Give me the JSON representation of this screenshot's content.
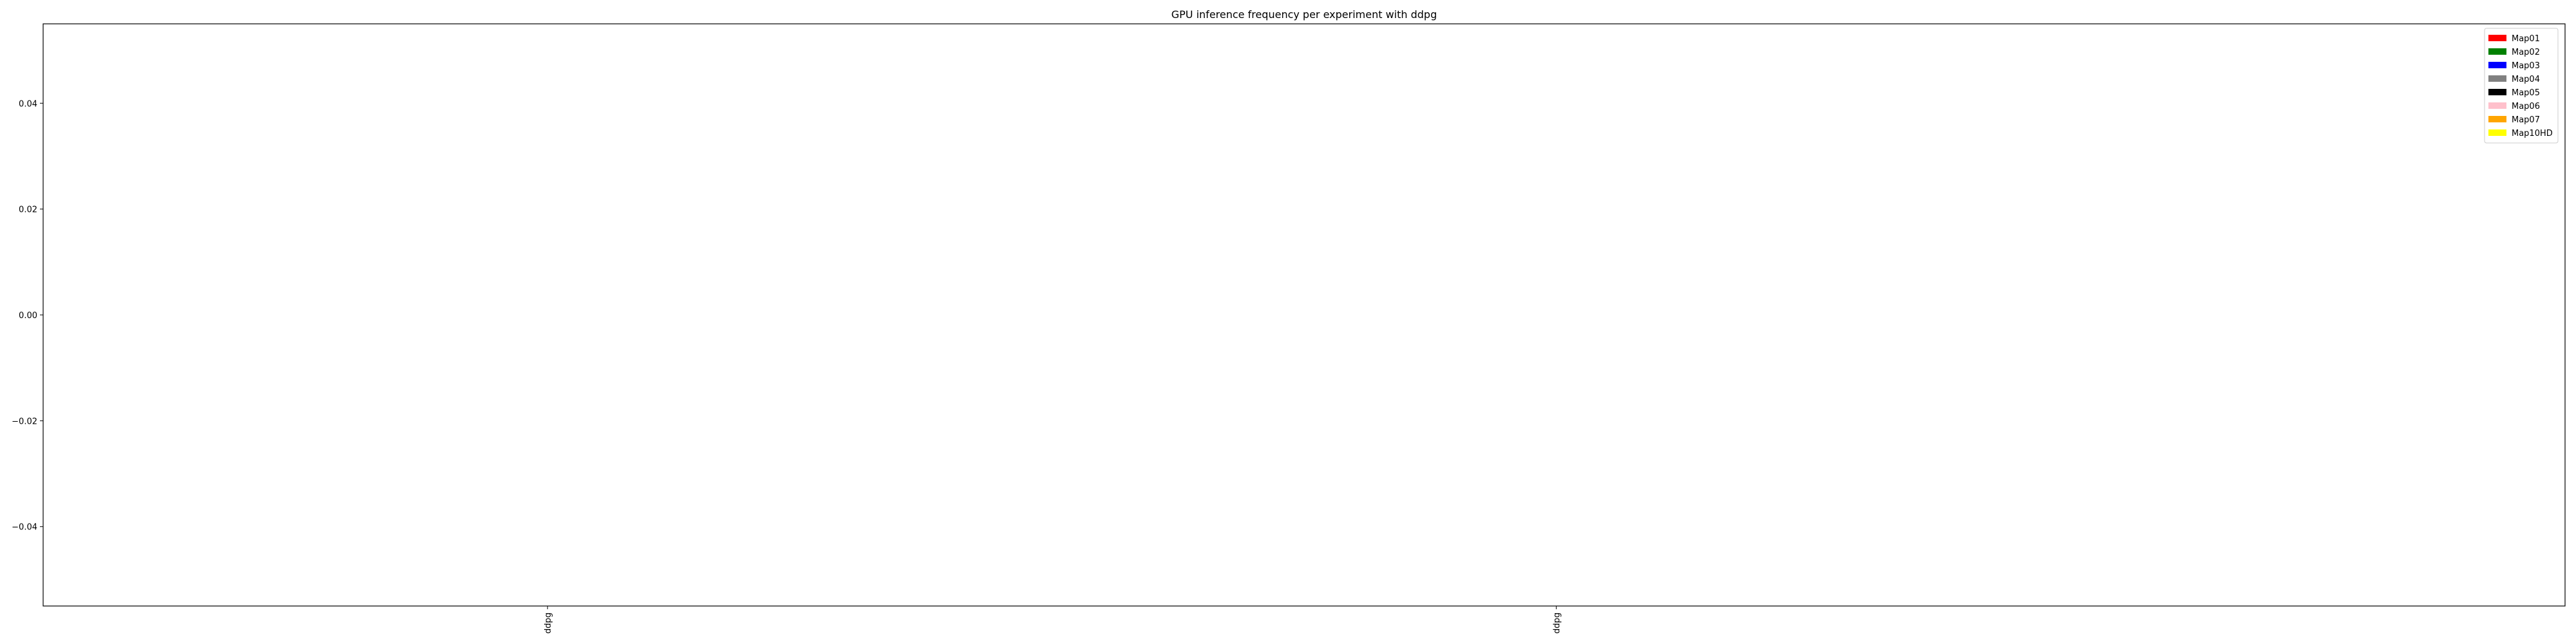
{
  "chart_data": {
    "type": "bar",
    "title": "GPU inference frequency per experiment with ddpg",
    "xlabel": "",
    "ylabel": "",
    "categories": [
      "ddpg",
      "ddpg"
    ],
    "ylim": [
      -0.055,
      0.055
    ],
    "yticks": [
      0.04,
      0.02,
      0.0,
      -0.02,
      -0.04
    ],
    "ytick_labels": [
      "0.04",
      "0.02",
      "0.00",
      "−0.02",
      "−0.04"
    ],
    "grid": false,
    "legend_position": "top-right",
    "series": [
      {
        "name": "Map01",
        "color": "#ff0000",
        "values": []
      },
      {
        "name": "Map02",
        "color": "#008000",
        "values": []
      },
      {
        "name": "Map03",
        "color": "#0000ff",
        "values": []
      },
      {
        "name": "Map04",
        "color": "#808080",
        "values": []
      },
      {
        "name": "Map05",
        "color": "#000000",
        "values": []
      },
      {
        "name": "Map06",
        "color": "#ffc0cb",
        "values": []
      },
      {
        "name": "Map07",
        "color": "#ffa500",
        "values": []
      },
      {
        "name": "Map10HD",
        "color": "#ffff00",
        "values": []
      }
    ]
  }
}
